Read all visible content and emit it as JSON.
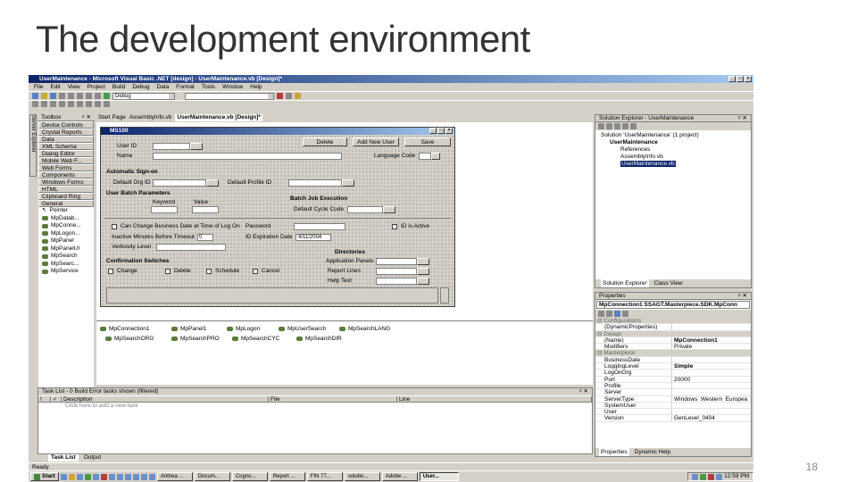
{
  "slide": {
    "title": "The development environment",
    "page_number": "18"
  },
  "window": {
    "title": "UserMaintenance - Microsoft Visual Basic .NET [design] - UserMaintenance.vb [Design]*"
  },
  "menu": [
    "File",
    "Edit",
    "View",
    "Project",
    "Build",
    "Debug",
    "Data",
    "Format",
    "Tools",
    "Window",
    "Help"
  ],
  "toolbar": {
    "config": "Debug"
  },
  "toolbox": {
    "title": "Toolbox",
    "tabs": [
      "Device Controls",
      "Crystal Reports",
      "Data",
      "XML Schema",
      "Dialog Editor",
      "Mobile Web F...",
      "Web Forms",
      "Components",
      "Windows Forms",
      "HTML",
      "Clipboard Ring",
      "General"
    ],
    "pointer": "Pointer",
    "components": [
      "MpDatab...",
      "MpConne...",
      "MpLogon...",
      "MpPanel",
      "MpPanelUI",
      "MpSearch",
      "MpSearc...",
      "MpService"
    ]
  },
  "server_explorer_tab": "Server Explorer",
  "doc_tabs": [
    "Start Page",
    "AssemblyInfo.vb",
    "UserMaintenance.vb [Design]*"
  ],
  "form": {
    "title": "MS100",
    "buttons": {
      "delete": "Delete",
      "add_new_user": "Add New User",
      "save": "Save"
    },
    "user_id": "User ID",
    "name": "Name",
    "language_code": "Language Code",
    "auto_signon": "Automatic Sign-on",
    "default_org_id": "Default Org ID",
    "default_profile_id": "Default Profile ID",
    "batch_params": "User Batch Parameters",
    "keyword": "Keyword",
    "value": "Value",
    "batch_job": "Batch Job Execution",
    "default_cycle_code": "Default Cycle Code",
    "change_business_date": "Can Change Business Date at Time of Log On",
    "password": "Password",
    "is_active": "ID is Active",
    "inactive_minutes": "Inactive Minutes Before Timeout",
    "inactive_value": "0",
    "id_expiration": "ID Expiration Date",
    "id_expiration_value": "4/11/2004",
    "verbosity": "Verbosity Level",
    "directories": "Directories",
    "confirmation": "Confirmation Switches",
    "change": "Change",
    "delete_chk": "Delete",
    "schedule": "Schedule",
    "cancel": "Cancel",
    "application_panels": "Application Panels",
    "report_lines": "Report Lines",
    "help_text": "Help Text"
  },
  "tray": [
    "MpConnection1",
    "MpPanel1",
    "MpLogon",
    "MpUserSearch",
    "MpSearchLANG",
    "MpSearchORG",
    "MpSearchPRO",
    "MpSearchCYC",
    "MpSearchDIR"
  ],
  "tasklist": {
    "title": "Task List - 0 Build Error tasks shown (filtered)",
    "cols": [
      "!",
      "✓",
      "Description",
      "File",
      "Line"
    ],
    "placeholder": "Click here to add a new task"
  },
  "bottom_tabs": [
    "Task List",
    "Output"
  ],
  "solution": {
    "title": "Solution Explorer - UserMaintenance",
    "items": [
      "Solution 'UserMaintenance' (1 project)",
      "UserMaintenance",
      "References",
      "AssemblyInfo.vb",
      "UserMaintenance.vb"
    ],
    "tabs": [
      "Solution Explorer",
      "Class View"
    ]
  },
  "properties": {
    "title": "Properties",
    "selector": "MpConnection1 SSAGT.Masterpiece.SDK.MpConn",
    "rows": [
      {
        "k": "Configurations",
        "v": "",
        "cat": true
      },
      {
        "k": "(DynamicProperties)",
        "v": ""
      },
      {
        "k": "Design",
        "v": "",
        "cat": true
      },
      {
        "k": "(Name)",
        "v": "MpConnection1",
        "bold": true
      },
      {
        "k": "Modifiers",
        "v": "Private"
      },
      {
        "k": "Masterpiece",
        "v": "",
        "cat": true
      },
      {
        "k": "BusinessDate",
        "v": ""
      },
      {
        "k": "LoggingLevel",
        "v": "Simple",
        "bold": true
      },
      {
        "k": "LogOnOrg",
        "v": ""
      },
      {
        "k": "Port",
        "v": "20000"
      },
      {
        "k": "Profile",
        "v": ""
      },
      {
        "k": "Server",
        "v": ""
      },
      {
        "k": "ServerType",
        "v": "Windows_Western_Europea"
      },
      {
        "k": "SystemUser",
        "v": ""
      },
      {
        "k": "User",
        "v": ""
      },
      {
        "k": "Version",
        "v": "GenLevel_0404"
      }
    ],
    "tabs": [
      "Properties",
      "Dynamic Help"
    ]
  },
  "status": "Ready",
  "taskbar": {
    "start": "Start",
    "tasks": [
      "Anthea ...",
      "Docum...",
      "Cogno...",
      "Report ...",
      "FIN 77...",
      "solutio...",
      "Adobe ...",
      "User..."
    ],
    "clock": "12:59 PM"
  }
}
